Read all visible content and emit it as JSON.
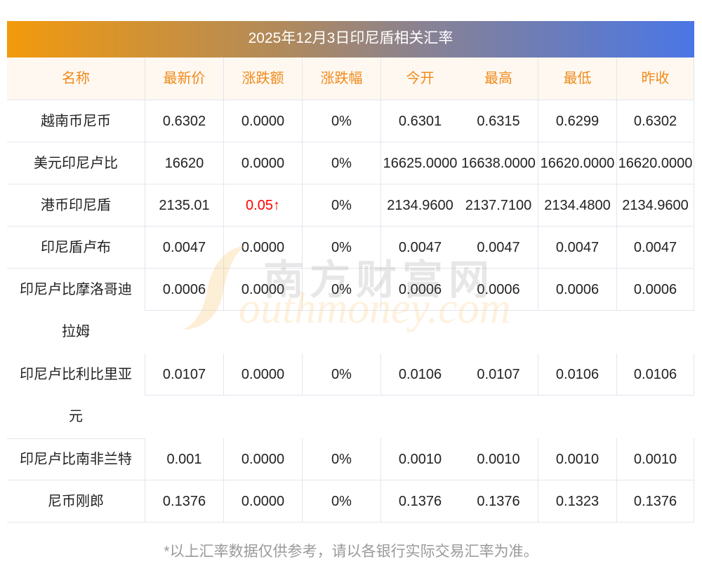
{
  "title": "2025年12月3日印尼盾相关汇率",
  "headers": [
    "名称",
    "最新价",
    "涨跌额",
    "涨跌幅",
    "今开",
    "最高",
    "最低",
    "昨收"
  ],
  "rows": [
    {
      "name": [
        "越南币尼币"
      ],
      "values": [
        "0.6302",
        "0.0000",
        "0%",
        "0.6301",
        "0.6315",
        "0.6299",
        "0.6302"
      ]
    },
    {
      "name": [
        "美元印尼卢比"
      ],
      "values": [
        "16620",
        "0.0000",
        "0%",
        "16625.0000",
        "16638.0000",
        "16620.0000",
        "16620.0000"
      ]
    },
    {
      "name": [
        "港币印尼盾"
      ],
      "values": [
        "2135.01",
        "0.05↑",
        "0%",
        "2134.9600",
        "2137.7100",
        "2134.4800",
        "2134.9600"
      ],
      "up": true
    },
    {
      "name": [
        "印尼盾卢布"
      ],
      "values": [
        "0.0047",
        "0.0000",
        "0%",
        "0.0047",
        "0.0047",
        "0.0047",
        "0.0047"
      ]
    },
    {
      "name": [
        "印尼卢比摩洛哥迪",
        "拉姆"
      ],
      "values": [
        "0.0006",
        "0.0000",
        "0%",
        "0.0006",
        "0.0006",
        "0.0006",
        "0.0006"
      ]
    },
    {
      "name": [
        "印尼卢比利比里亚",
        "元"
      ],
      "values": [
        "0.0107",
        "0.0000",
        "0%",
        "0.0106",
        "0.0107",
        "0.0106",
        "0.0106"
      ]
    },
    {
      "name": [
        "印尼卢比南非兰特"
      ],
      "values": [
        "0.001",
        "0.0000",
        "0%",
        "0.0010",
        "0.0010",
        "0.0010",
        "0.0010"
      ]
    },
    {
      "name": [
        "尼币刚郎"
      ],
      "values": [
        "0.1376",
        "0.0000",
        "0%",
        "0.1376",
        "0.1376",
        "0.1323",
        "0.1376"
      ]
    }
  ],
  "watermark": {
    "cn": "南方财富网",
    "en": "outhmoney.com"
  },
  "footer": "*以上汇率数据仅供参考，请以各银行实际交易汇率为准。",
  "colors": {
    "up": "#ff0000",
    "header_text": "#f08a1c",
    "header_bg": "#fef8f0"
  }
}
